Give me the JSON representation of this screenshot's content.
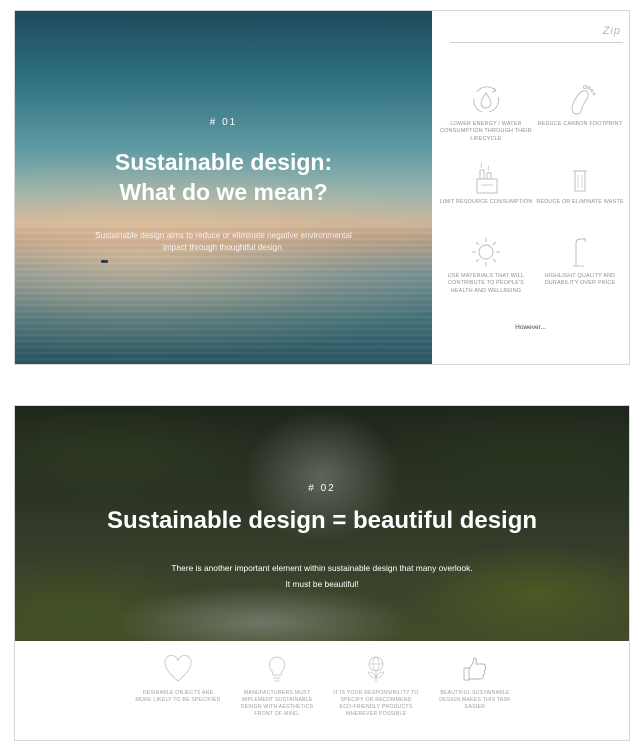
{
  "slide1": {
    "number": "# 01",
    "title_line1": "Sustainable design:",
    "title_line2": "What do we mean?",
    "description": "Sustainable design aims to reduce or eliminate negative environmental impact through thoughtful design.",
    "logo": "Zip",
    "features": [
      {
        "icon": "water-cycle-icon",
        "label": "LOWER ENERGY / WATER CONSUMPTION THROUGH THEIR LIFECYCLE"
      },
      {
        "icon": "footprint-icon",
        "label": "REDUCE CARBON FOOTPRINT"
      },
      {
        "icon": "factory-icon",
        "label": "LIMIT RESOURCE CONSUMPTION"
      },
      {
        "icon": "bin-icon",
        "label": "REDUCE OR ELIMINATE WASTE"
      },
      {
        "icon": "sun-icon",
        "label": "USE MATERIALS THAT WILL CONTRIBUTE TO PEOPLE'S HEALTH AND WELLBEING"
      },
      {
        "icon": "tap-icon",
        "label": "HIGHLIGHT QUALITY AND DURABILITY OVER PRICE"
      }
    ],
    "however": "However..."
  },
  "slide2": {
    "number": "# 02",
    "title": "Sustainable design  =  beautiful design",
    "description_line1": "There is another important element within sustainable design that many overlook.",
    "description_line2": "It must be beautiful!",
    "points": [
      {
        "icon": "heart-icon",
        "label": "DESIRABLE OBJECTS ARE MORE LIKELY TO BE SPECIFIED"
      },
      {
        "icon": "lightbulb-icon",
        "label": "MANUFACTURERS MUST IMPLEMENT SUSTAINABLE DESIGN WITH AESTHETICS FRONT OF MIND."
      },
      {
        "icon": "globe-plant-icon",
        "label": "IT IS YOUR RESPONSIBILITY TO SPECIFY OR RECOMMEND ECO-FRIENDLY PRODUCTS WHEREVER POSSIBLE"
      },
      {
        "icon": "thumbs-up-icon",
        "label": "BEAUTIFUL SUSTAINABLE DESIGN MAKES THIS TASK EASIER"
      }
    ]
  },
  "colors": {
    "icon_stroke": "#b8b8b8",
    "label_text": "#8f8f8f",
    "heading_text": "#ffffff"
  }
}
